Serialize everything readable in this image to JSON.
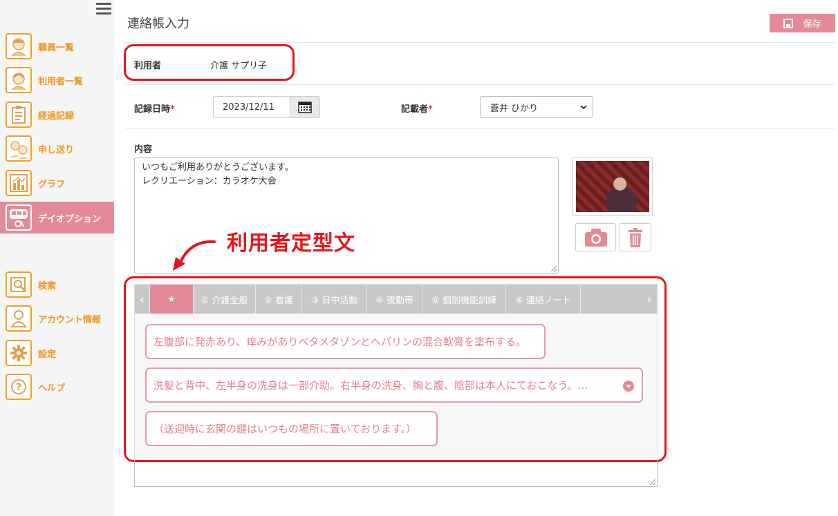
{
  "page_title": "連絡帳入力",
  "save_button": "保存",
  "sidebar": {
    "items": [
      {
        "label": "職員一覧",
        "icon": "staff-icon"
      },
      {
        "label": "利用者一覧",
        "icon": "user-list-icon"
      },
      {
        "label": "経過記録",
        "icon": "clipboard-icon"
      },
      {
        "label": "申し送り",
        "icon": "handover-icon"
      },
      {
        "label": "グラフ",
        "icon": "graph-icon"
      },
      {
        "label": "デイオプション",
        "icon": "day-option-icon"
      },
      {
        "label": "検索",
        "icon": "search-icon"
      },
      {
        "label": "アカウント情報",
        "icon": "account-icon"
      },
      {
        "label": "設定",
        "icon": "gear-icon"
      },
      {
        "label": "ヘルプ",
        "icon": "help-icon"
      }
    ]
  },
  "form": {
    "user_label": "利用者",
    "user_name": "介護 サプリ子",
    "date_label": "記録日時",
    "required_mark": "*",
    "date_value": "2023/12/11",
    "recorder_label": "記載者",
    "recorder_value": "蒼井 ひかり",
    "content_label": "内容",
    "content_value": "いつもご利用ありがとうございます。\nレクリエーション：カラオケ大会"
  },
  "annotation": "利用者定型文",
  "phrase_tabs": [
    "★",
    "① 介護全般",
    "② 看護",
    "③ 日中活動",
    "④ 夜勤帯",
    "⑤ 個別機能訓練",
    "⑥ 連絡ノート"
  ],
  "phrases": [
    "左腹部に発赤あり、痒みがありベタメタゾンとヘパリンの混合軟膏を塗布する。",
    "洗髪と背中、左半身の洗身は一部介助。右半身の洗身、胸と腹、陰部は本人にておこなう。…",
    "（送迎時に玄関の鍵はいつもの場所に置いております。）"
  ],
  "colors": {
    "accent_pink": "#e48a97",
    "sidebar_orange": "#f0961e",
    "annotation_red": "#e8121a"
  }
}
